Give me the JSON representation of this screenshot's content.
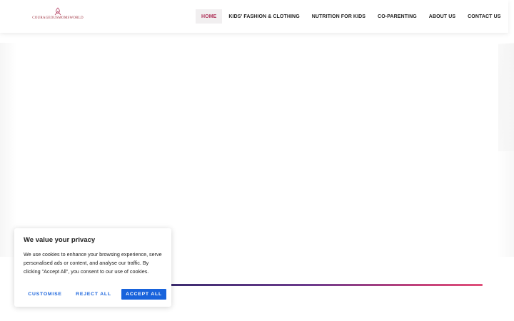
{
  "brand": {
    "logo_text": "COURAGEOUSMOMSWORLD",
    "accent_color": "#b0355b"
  },
  "nav": {
    "items": [
      {
        "label": "HOME",
        "active": true
      },
      {
        "label": "KIDS' FASHION & CLOTHING",
        "active": false
      },
      {
        "label": "NUTRITION FOR KIDS",
        "active": false
      },
      {
        "label": "CO-PARENTING",
        "active": false
      },
      {
        "label": "ABOUT US",
        "active": false
      },
      {
        "label": "CONTACT US",
        "active": false
      }
    ]
  },
  "cookie_banner": {
    "title": "We value your privacy",
    "text": "We use cookies to enhance your browsing experience, serve personalised ads or content, and analyse our traffic. By clicking \"Accept All\", you consent to our use of cookies.",
    "customise_label": "CUSTOMISE",
    "reject_label": "REJECT ALL",
    "accept_label": "ACCEPT ALL",
    "button_color": "#1863dc"
  }
}
